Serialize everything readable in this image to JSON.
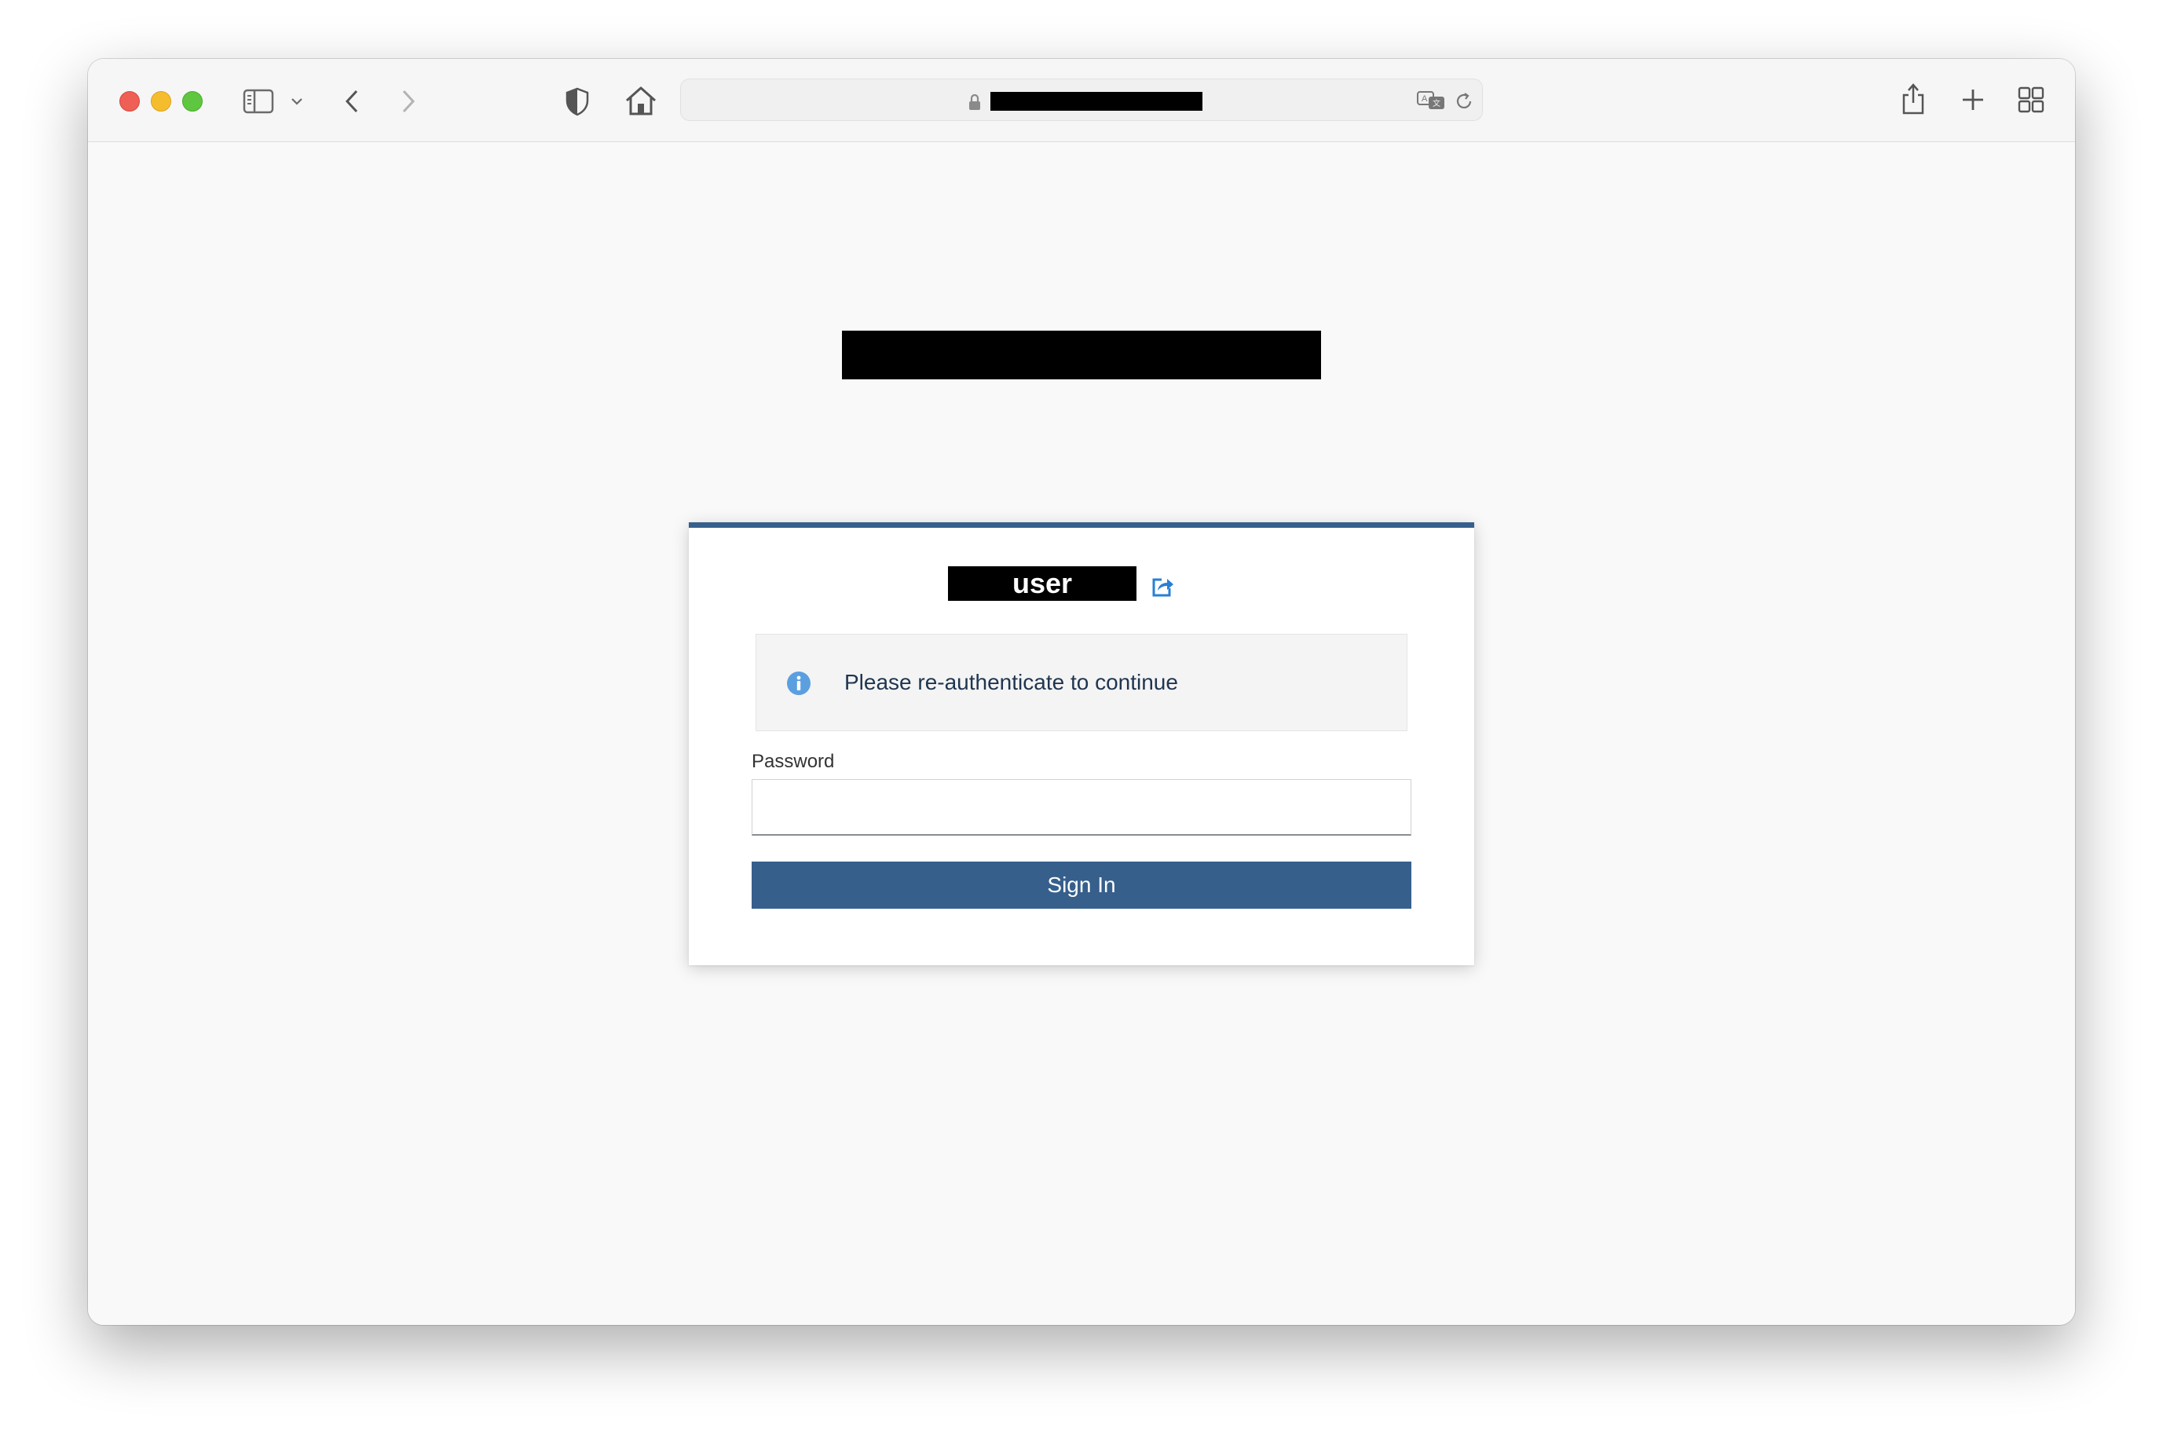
{
  "browser": {
    "url_redacted": true,
    "icons": {
      "sidebar": "sidebar-icon",
      "chevron": "chevron-down-icon",
      "back": "back-arrow-icon",
      "forward": "forward-arrow-icon",
      "privacy": "shield-icon",
      "home": "home-icon",
      "lock": "lock-icon",
      "translate": "translate-icon",
      "reload": "reload-icon",
      "share": "share-icon",
      "new_tab": "plus-icon",
      "tab_overview": "grid-icon"
    }
  },
  "page": {
    "header_redacted": true
  },
  "card": {
    "username": "user",
    "alert_text": "Please re-authenticate to continue",
    "password_label": "Password",
    "password_value": "",
    "sign_in_label": "Sign In"
  },
  "colors": {
    "accent": "#365f8c",
    "alert_icon": "#5b9fe0",
    "link_icon": "#2a7fd4"
  }
}
